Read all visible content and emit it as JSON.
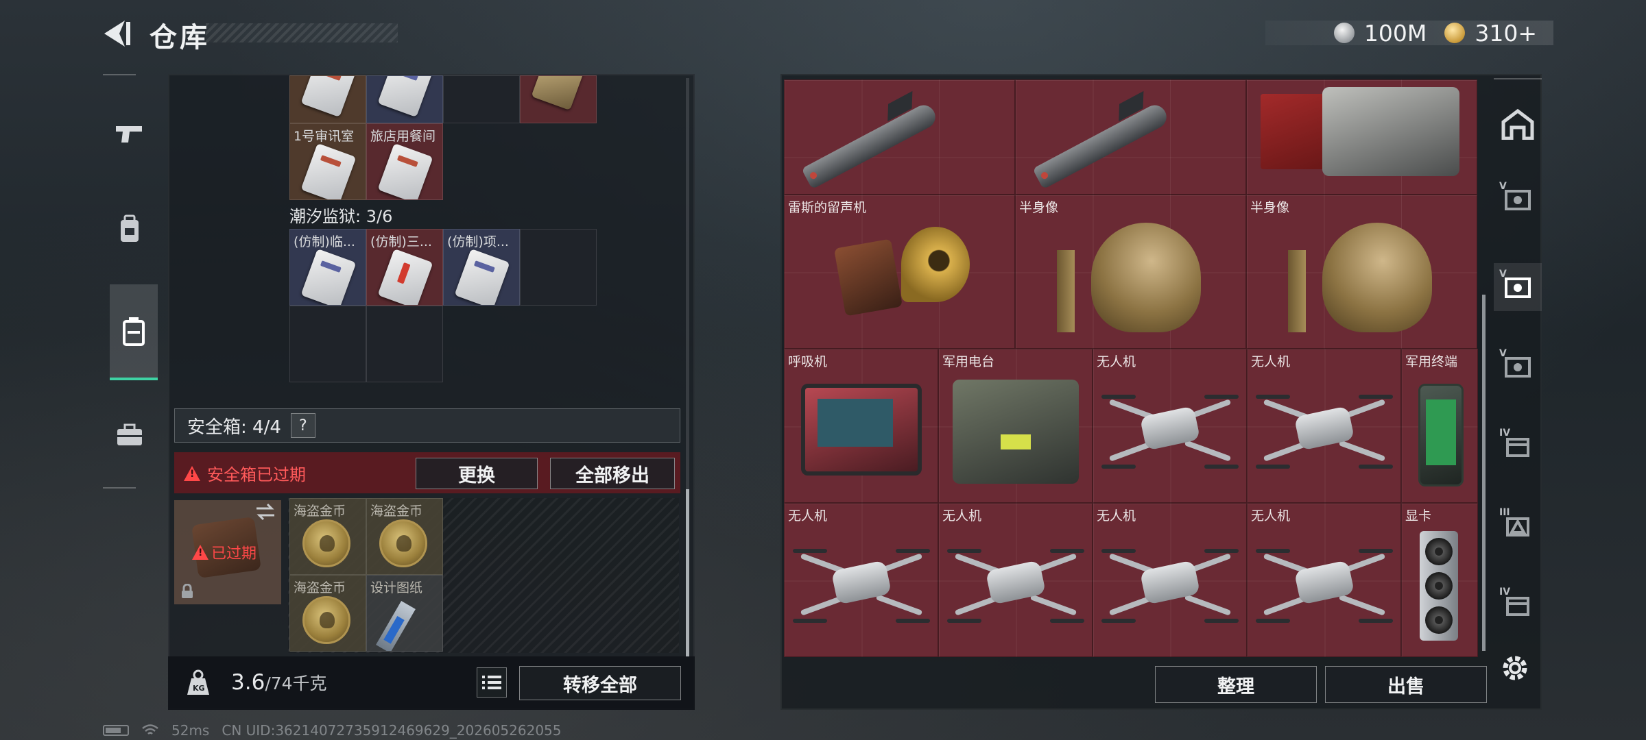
{
  "header": {
    "title": "仓库"
  },
  "currency": [
    {
      "icon": "silver-coin-icon",
      "value": "100M"
    },
    {
      "icon": "gold-coin-icon",
      "value": "310+"
    }
  ],
  "left_tabs": [
    {
      "icon": "pistol-icon"
    },
    {
      "icon": "backpack-icon"
    },
    {
      "icon": "safebox-icon",
      "active": true
    },
    {
      "icon": "briefcase-icon"
    }
  ],
  "left_grid": {
    "rooms_labels": [
      "1号审讯室",
      "旅店用餐间"
    ],
    "prison": {
      "label": "潮汐监狱: 3/6",
      "items": [
        "(仿制)临...",
        "(仿制)三...",
        "(仿制)项..."
      ]
    }
  },
  "safe_box": {
    "label": "安全箱: 4/4",
    "help": "?",
    "expired_msg": "安全箱已过期",
    "replace_btn": "更换",
    "remove_all_btn": "全部移出",
    "case_status": "已过期",
    "items": [
      "海盗金币",
      "海盗金币",
      "海盗金币",
      "设计图纸"
    ]
  },
  "bottom_left": {
    "weight_current": "3.6",
    "weight_max": "/74千克",
    "transfer_all": "转移全部"
  },
  "right_grid": {
    "items": [
      "雷斯的留声机",
      "半身像",
      "半身像",
      "呼吸机",
      "军用电台",
      "无人机",
      "无人机",
      "军用终端",
      "无人机",
      "无人机",
      "无人机",
      "无人机",
      "显卡"
    ]
  },
  "bottom_right": {
    "organize_btn": "整理",
    "sell_btn": "出售"
  },
  "right_tabs": [
    {
      "icon": "base-icon",
      "tier": ""
    },
    {
      "icon": "vault-icon",
      "tier": "V"
    },
    {
      "icon": "vault-icon",
      "tier": "V",
      "active": true
    },
    {
      "icon": "vault-icon",
      "tier": "V"
    },
    {
      "icon": "vault-icon",
      "tier": "IV"
    },
    {
      "icon": "vault-icon",
      "tier": "III"
    },
    {
      "icon": "vault-icon",
      "tier": "IV"
    }
  ],
  "status_bar": {
    "ping": "52ms",
    "uid": "CN UID:36214072735912469629_202605262055"
  },
  "colors": {
    "accent_green": "#3ed3a4",
    "expired_red": "#ff4848",
    "cell_red": "#6a2a34"
  }
}
